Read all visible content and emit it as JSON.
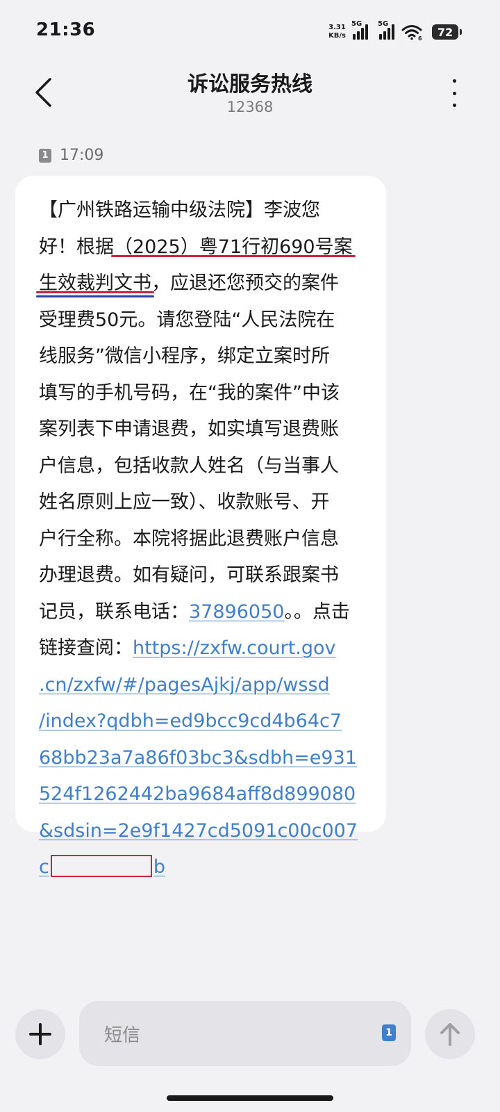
{
  "status_bar": {
    "time": "21:36",
    "net_speed_value": "3.31",
    "net_speed_unit": "KB/s",
    "sim1_network": "5G",
    "sim2_network": "5G",
    "wifi_band": "6",
    "battery": "72"
  },
  "header": {
    "title": "诉讼服务热线",
    "number": "12368",
    "back_icon": "chevron-left-icon",
    "more_icon": "more-vertical-icon"
  },
  "message": {
    "sim_slot": "1",
    "time": "17:09",
    "lines": [
      "【广州铁路运输中级法院】李波您",
      "好！根据",
      "生效裁判文书",
      "，应退还您预交的案件",
      "受理费50元。请您登陆“人民法院在",
      "线服务”微信小程序，绑定立案时所",
      "填写的手机号码，在“我的案件”中该",
      "案列表下申请退费，如实填写退费账",
      "户信息，包括收款人姓名（与当事人",
      "姓名原则上应一致）、收款账号、开",
      "户行全称。本院将据此退费账户信息",
      "办理退费。如有疑问，可联系跟案书",
      "记员，联系电话：",
      "。。点击",
      "链接查阅："
    ],
    "case_number": "（2025）粤71行初690号案",
    "phone": "37896050",
    "url_lines": [
      "https://zxfw.court.gov",
      ".cn/zxfw/#/pagesAjkj/app/wssd",
      "/index?qdbh=ed9bcc9cd4b64c7",
      "68bb23a7a86f03bc3&sdbh=e931",
      "524f1262442ba9684aff8d899080",
      "&sdsin=2e9f1427cd5091c00c007"
    ],
    "url_tail_start": "c",
    "url_tail_end": "b"
  },
  "input": {
    "placeholder": "短信",
    "sim_slot": "1",
    "add_icon": "plus-icon",
    "send_icon": "arrow-up-icon"
  },
  "colors": {
    "link": "#3f7fd0",
    "annotation_red": "#d2233c",
    "annotation_blue": "#2e3fa8",
    "background": "#f2f2f4",
    "bubble": "#ffffff"
  }
}
